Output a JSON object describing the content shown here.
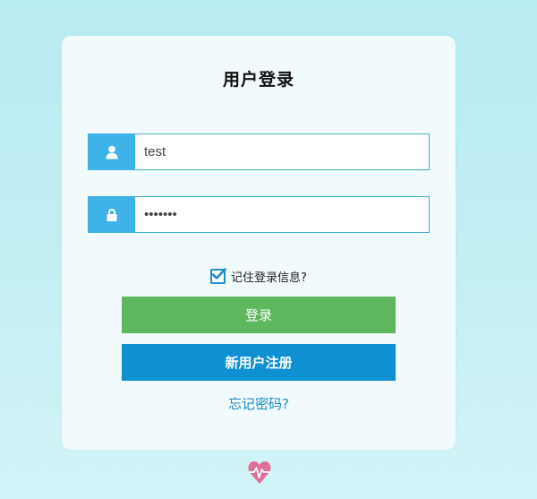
{
  "login": {
    "title": "用户登录",
    "username_value": "test",
    "password_value": "1234567",
    "remember_label": "记住登录信息?",
    "remember_checked": true,
    "login_button_label": "登录",
    "register_button_label": "新用户注册",
    "forgot_link_label": "忘记密码?"
  },
  "icons": {
    "user": "user-icon",
    "lock": "lock-icon",
    "checkbox": "check-icon",
    "footer": "heart-pulse-icon"
  },
  "colors": {
    "icon_addon": "#3db3ea",
    "login_button": "#5eb95e",
    "register_button": "#0e90d2",
    "link": "#1a8cc4",
    "heart": "#e0709a"
  }
}
